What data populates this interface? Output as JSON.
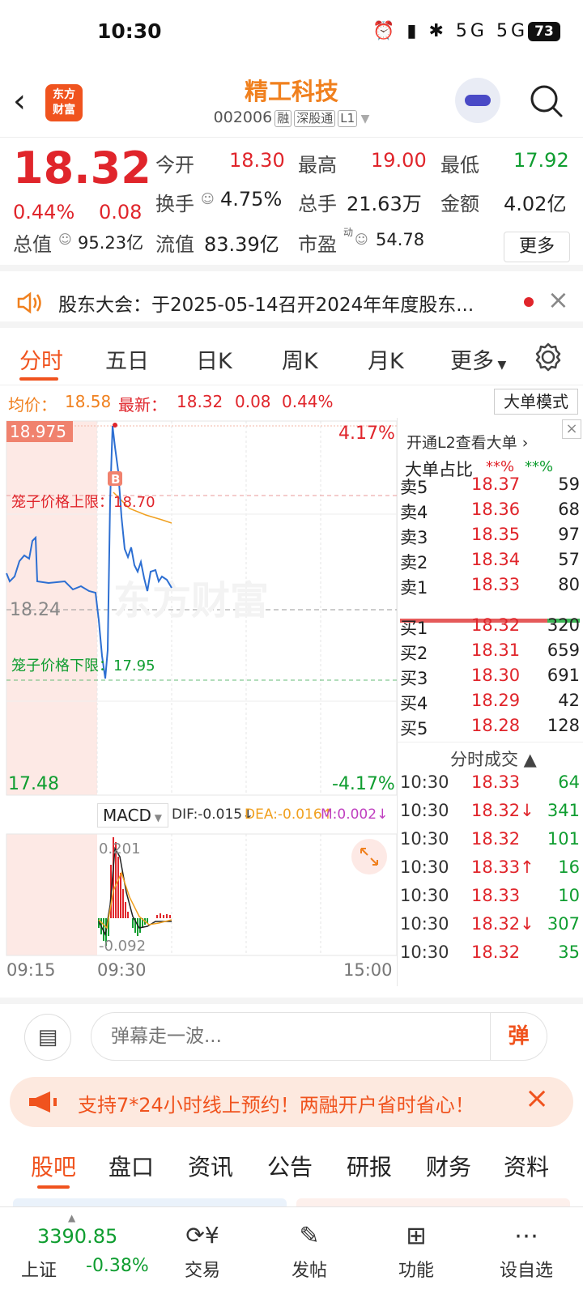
{
  "status": {
    "time": "10:30",
    "icons": "⏰ ▮ ✱ 5G 5G",
    "battery": "73"
  },
  "header": {
    "name": "精工科技",
    "code": "002006",
    "tags": [
      "融",
      "深股通",
      "L1"
    ]
  },
  "quote": {
    "price": "18.32",
    "pct": "0.44%",
    "chg": "0.08",
    "open_label": "今开",
    "open": "18.30",
    "high_label": "最高",
    "high": "19.00",
    "low_label": "最低",
    "low": "17.92",
    "turnover_label": "换手",
    "turnover": "4.75%",
    "volume_label": "总手",
    "volume": "21.63万",
    "amount_label": "金额",
    "amount": "4.02亿",
    "mcap_label": "总值",
    "mcap": "95.23亿",
    "float_label": "流值",
    "float": "83.39亿",
    "pe_label": "市盈",
    "pe_sup": "动",
    "pe": "54.78",
    "more": "更多"
  },
  "notice": {
    "text": "股东大会：于2025-05-14召开2024年年度股东..."
  },
  "tabs": [
    "分时",
    "五日",
    "日K",
    "周K",
    "月K",
    "更多"
  ],
  "infoline": {
    "avg_label": "均价：",
    "avg": "18.58",
    "last_label": "最新：",
    "last": "18.32",
    "chg": "0.08",
    "pct": "0.44%",
    "big_mode": "大单模式"
  },
  "chart": {
    "top_price": "18.975",
    "top_pct": "4.17%",
    "mid_price": "18.24",
    "bottom_price": "17.48",
    "bottom_pct": "-4.17%",
    "upper_limit": "笼子价格上限：18.70",
    "lower_limit": "笼子价格下限：17.95",
    "watermark": "东方财富",
    "buy_marker": "B"
  },
  "chart_data": {
    "type": "line",
    "title": "",
    "xlabel": "",
    "ylabel": "",
    "ylim": [
      17.48,
      18.975
    ],
    "x": [
      "09:15",
      "09:30",
      "15:00"
    ],
    "series": []
  },
  "macd": {
    "label": "MACD",
    "dif": "DIF:-0.015↓",
    "dea": "DEA:-0.016↑",
    "m": "M:0.002↓",
    "top": "0.201",
    "bottom": "-0.092"
  },
  "timeaxis": {
    "start": "09:15",
    "open": "09:30",
    "end": "15:00"
  },
  "orderbook": {
    "l2": "开通L2查看大单 ›",
    "big_label": "大单占比",
    "big1": "**%",
    "big2": "**%",
    "sells": [
      {
        "l": "卖5",
        "p": "18.37",
        "v": "59"
      },
      {
        "l": "卖4",
        "p": "18.36",
        "v": "68"
      },
      {
        "l": "卖3",
        "p": "18.35",
        "v": "97"
      },
      {
        "l": "卖2",
        "p": "18.34",
        "v": "57"
      },
      {
        "l": "卖1",
        "p": "18.33",
        "v": "80"
      }
    ],
    "buys": [
      {
        "l": "买1",
        "p": "18.32",
        "v": "320"
      },
      {
        "l": "买2",
        "p": "18.31",
        "v": "659"
      },
      {
        "l": "买3",
        "p": "18.30",
        "v": "691"
      },
      {
        "l": "买4",
        "p": "18.29",
        "v": "42"
      },
      {
        "l": "买5",
        "p": "18.28",
        "v": "128"
      }
    ],
    "trades_label": "分时成交 ▲",
    "trades": [
      {
        "t": "10:30",
        "p": "18.33",
        "v": "64"
      },
      {
        "t": "10:30",
        "p": "18.32↓",
        "v": "341"
      },
      {
        "t": "10:30",
        "p": "18.32",
        "v": "101"
      },
      {
        "t": "10:30",
        "p": "18.33↑",
        "v": "16"
      },
      {
        "t": "10:30",
        "p": "18.33",
        "v": "10"
      },
      {
        "t": "10:30",
        "p": "18.32↓",
        "v": "307"
      },
      {
        "t": "10:30",
        "p": "18.32",
        "v": "35"
      }
    ]
  },
  "danmu": {
    "placeholder": "弹幕走一波...",
    "btn": "弹"
  },
  "promo": {
    "text": "支持7*24小时线上预约！两融开户省时省心！"
  },
  "tabs2": [
    "股吧",
    "盘口",
    "资讯",
    "公告",
    "研报",
    "财务",
    "资料"
  ],
  "bottom": {
    "index_val": "3390.85",
    "index_name": "上证",
    "index_pct": "-0.38%",
    "items": [
      "交易",
      "发帖",
      "功能",
      "设自选"
    ]
  }
}
